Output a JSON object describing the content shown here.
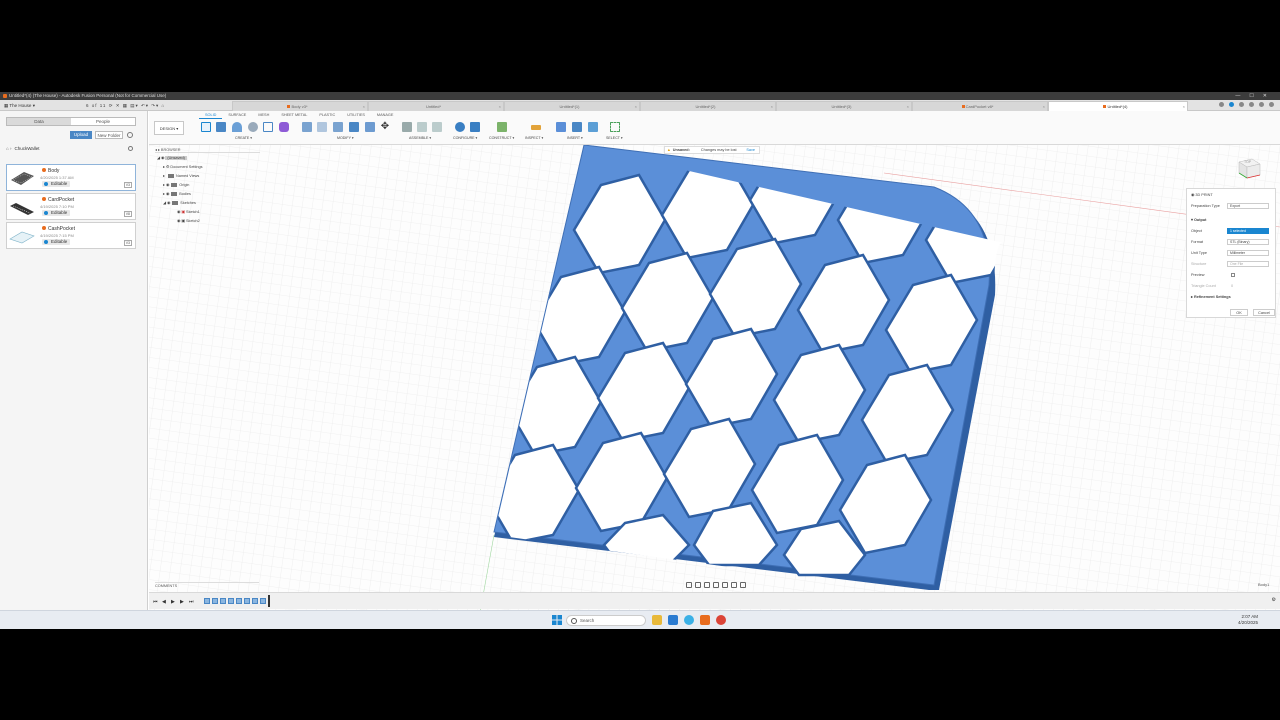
{
  "window": {
    "title": "Untitled*(4) (The House) - Autodesk Fusion Personal (Not for Commercial Use)",
    "controls": [
      "—",
      "☐",
      "✕"
    ]
  },
  "hub": {
    "label": "The House",
    "counter": "6 of 11"
  },
  "doc_tabs": [
    {
      "label": "Body v3*"
    },
    {
      "label": "Untitled*"
    },
    {
      "label": "Untitled*(1)"
    },
    {
      "label": "Untitled*(2)"
    },
    {
      "label": "Untitled*(3)"
    },
    {
      "label": "CardPocket v8*"
    },
    {
      "label": "Untitled*(4)"
    }
  ],
  "data_panel": {
    "tabs": [
      "Data",
      "People"
    ],
    "upload": "Upload",
    "new_folder": "New Folder",
    "breadcrumb": "ChuckWallet",
    "files": [
      {
        "name": "Body",
        "date": "4/20/2025 1:37 AM",
        "status": "Editable",
        "version": "V3"
      },
      {
        "name": "CardPocket",
        "date": "4/19/2025 7:10 PM",
        "status": "Editable",
        "version": "V8"
      },
      {
        "name": "CashPocket",
        "date": "4/19/2025 7:15 PM",
        "status": "Editable",
        "version": "V3"
      }
    ]
  },
  "toolbar": {
    "design": "DESIGN ▾",
    "workspaces": [
      "SOLID",
      "SURFACE",
      "MESH",
      "SHEET METAL",
      "PLASTIC",
      "UTILITIES",
      "MANAGE"
    ],
    "groups": [
      "CREATE ▾",
      "MODIFY ▾",
      "ASSEMBLE ▾",
      "CONFIGURE ▾",
      "CONSTRUCT ▾",
      "INSPECT ▾",
      "INSERT ▾",
      "SELECT ▾"
    ]
  },
  "browser": {
    "title": "BROWSER",
    "root": "(Unsaved)",
    "items": [
      "Document Settings",
      "Named Views",
      "Origin",
      "Bodies",
      "Sketches",
      "Sketch1",
      "Sketch2"
    ]
  },
  "unsaved_bar": {
    "label": "Unsaved:",
    "message": "Changes may be lost",
    "save": "Save"
  },
  "viewcube": {
    "label": "TOP"
  },
  "export_dialog": {
    "title": "3D PRINT",
    "prep_label": "Preparation Type",
    "prep_value": "Export",
    "output": "Output",
    "object_label": "Object",
    "object_value": "1 selected",
    "format_label": "Format",
    "format_value": "STL (Binary)",
    "unit_label": "Unit Type",
    "unit_value": "Millimeter",
    "structure_label": "Structure",
    "structure_value": "One File",
    "preview_label": "Preview",
    "triangle_label": "Triangle Count",
    "triangle_value": "0",
    "refinement": "Refinement Settings",
    "ok": "OK",
    "cancel": "Cancel"
  },
  "comments": "COMMENTS",
  "body_label": "Body1",
  "taskbar": {
    "search": "Search",
    "time": "2:07 AM",
    "date": "4/20/2025"
  },
  "colors": {
    "model": "#5b8fd8",
    "accent": "#1a86d0",
    "fusion_orange": "#e86c1e"
  }
}
